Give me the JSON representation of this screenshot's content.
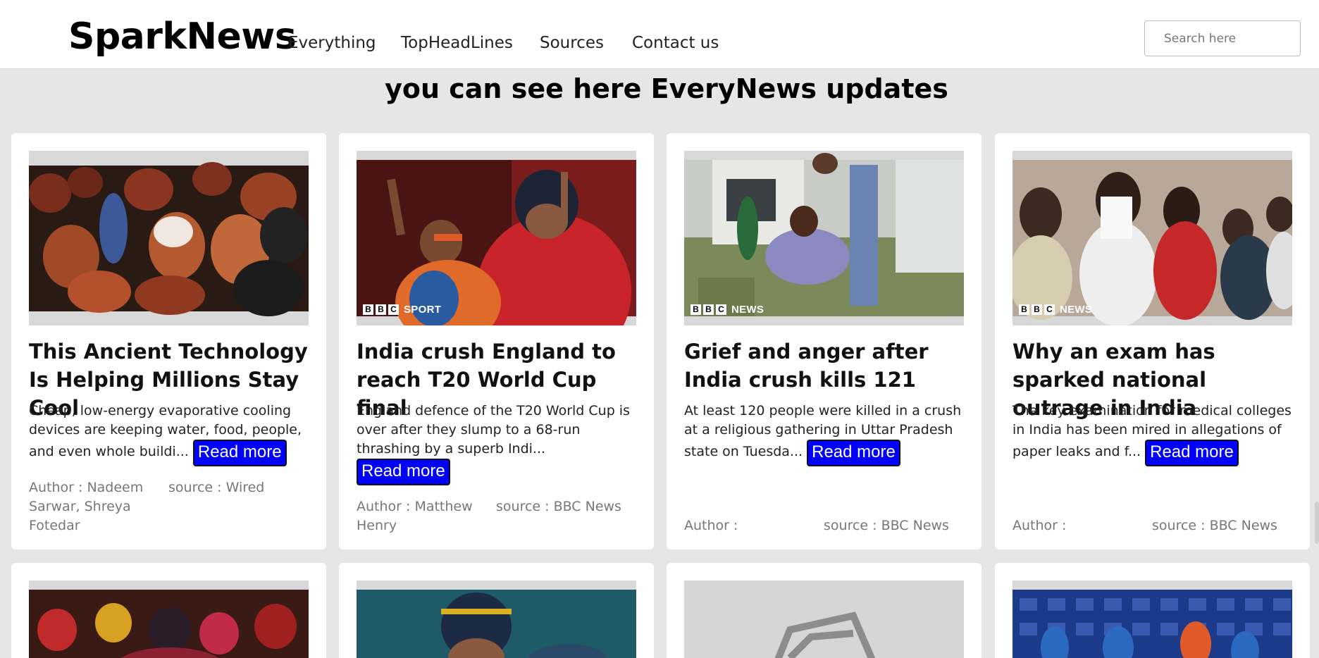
{
  "navbar": {
    "brand": "SparkNews",
    "links": [
      "Everything",
      "TopHeadLines",
      "Sources",
      "Contact us"
    ],
    "search_placeholder": "Search here"
  },
  "headline": "you can see here EveryNews updates",
  "read_more_label": "Read more",
  "cards": [
    {
      "title": "This Ancient Technology Is Helping Millions Stay Cool",
      "desc": "Cheap, low-energy evaporative cooling devices are keeping water, food, people, and even whole buildi...",
      "author": "Author : Nadeem Sarwar, Shreya Fotedar",
      "source": "source : Wired",
      "image": "clay-pots-photo"
    },
    {
      "title": "India crush England to reach T20 World Cup final",
      "desc": "England defence of the T20 World Cup is over after they slump to a 68-run thrashing by a superb Indi...",
      "author": "Author : Matthew Henry",
      "source": "source : BBC News",
      "image": "cricket-celebration-photo",
      "badge": "SPORT"
    },
    {
      "title": "Grief and anger after India crush kills 121",
      "desc": "At least 120 people were killed in a crush at a religious gathering in Uttar Pradesh state on Tuesda...",
      "author": "Author :",
      "source": "source : BBC News",
      "image": "ambulance-scene-photo",
      "badge": "NEWS"
    },
    {
      "title": "Why an exam has sparked national outrage in India",
      "desc": "The key examination for medical colleges in India has been mired in allegations of paper leaks and f...",
      "author": "Author :",
      "source": "source : BBC News",
      "image": "students-exam-photo",
      "badge": "NEWS"
    }
  ],
  "colors": {
    "page_bg": "#e6e6e6",
    "read_more_bg": "#0000ff"
  }
}
